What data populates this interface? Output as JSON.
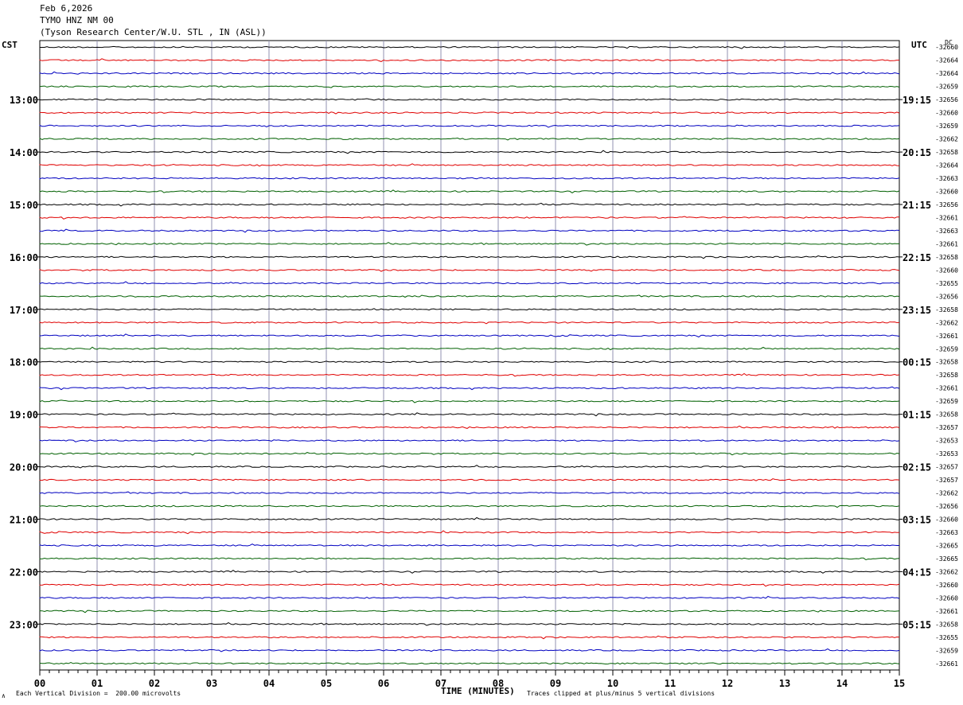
{
  "header": {
    "date": "Feb 6,2026",
    "station": "TYMO HNZ NM 00",
    "location": "(Tyson Research Center/W.U. STL , IN (ASL))"
  },
  "left_axis_label": "CST",
  "right_axis_label": "UTC",
  "dc_label": "DC",
  "footer": {
    "mark": "∧",
    "vertical_division": "Each Vertical Division =  200.00 microvolts",
    "clip_note": "Traces clipped at plus/minus 5 vertical divisions"
  },
  "chart_data": {
    "type": "line",
    "title": "",
    "xlabel": "TIME (MINUTES)",
    "ylabel": "",
    "xlim": [
      0,
      15
    ],
    "x_ticks": [
      "00",
      "01",
      "02",
      "03",
      "04",
      "05",
      "06",
      "07",
      "08",
      "09",
      "10",
      "11",
      "12",
      "13",
      "14",
      "15"
    ],
    "trace_colors": [
      "#000000",
      "#e00000",
      "#0000c0",
      "#006000"
    ],
    "grid": true,
    "left_hour_labels": [
      "13:00",
      "14:00",
      "15:00",
      "16:00",
      "17:00",
      "18:00",
      "19:00",
      "20:00",
      "21:00",
      "22:00",
      "23:00"
    ],
    "right_hour_labels": [
      "19:15",
      "20:15",
      "21:15",
      "22:15",
      "23:15",
      "00:15",
      "01:15",
      "02:15",
      "03:15",
      "04:15",
      "05:15"
    ],
    "dc_offsets": [
      -32660,
      -32664,
      -32664,
      -32659,
      -32656,
      -32660,
      -32659,
      -32662,
      -32658,
      -32664,
      -32663,
      -32660,
      -32656,
      -32661,
      -32663,
      -32661,
      -32658,
      -32660,
      -32655,
      -32656,
      -32658,
      -32662,
      -32661,
      -32659,
      -32658,
      -32658,
      -32661,
      -32659,
      -32658,
      -32657,
      -32653,
      -32653,
      -32657,
      -32657,
      -32662,
      -32656,
      -32660,
      -32663,
      -32665,
      -32665,
      -32662,
      -32660,
      -32660,
      -32661,
      -32658,
      -32655,
      -32659,
      -32661
    ]
  }
}
